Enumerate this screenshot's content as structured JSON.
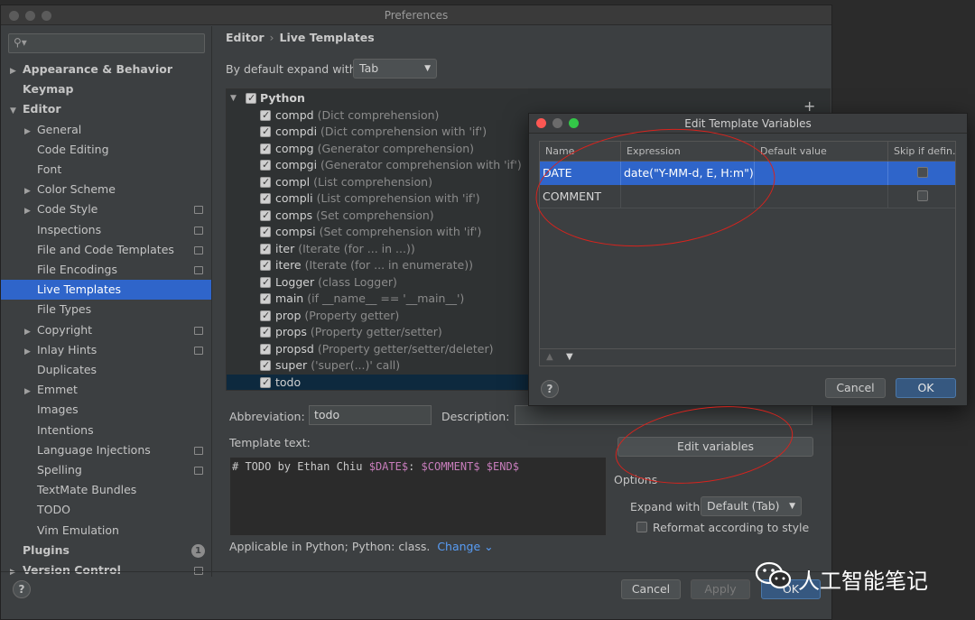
{
  "window": {
    "title": "Preferences"
  },
  "search": {
    "placeholder": ""
  },
  "sidebar": {
    "items": [
      {
        "label": "Appearance & Behavior",
        "bold": true,
        "arrow": "▶"
      },
      {
        "label": "Keymap",
        "bold": true
      },
      {
        "label": "Editor",
        "bold": true,
        "arrow": "▼"
      },
      {
        "label": "General",
        "arrow": "▶"
      },
      {
        "label": "Code Editing"
      },
      {
        "label": "Font"
      },
      {
        "label": "Color Scheme",
        "arrow": "▶"
      },
      {
        "label": "Code Style",
        "arrow": "▶",
        "copy": true
      },
      {
        "label": "Inspections",
        "copy": true
      },
      {
        "label": "File and Code Templates",
        "copy": true
      },
      {
        "label": "File Encodings",
        "copy": true
      },
      {
        "label": "Live Templates",
        "selected": true
      },
      {
        "label": "File Types"
      },
      {
        "label": "Copyright",
        "arrow": "▶",
        "copy": true
      },
      {
        "label": "Inlay Hints",
        "arrow": "▶",
        "copy": true
      },
      {
        "label": "Duplicates"
      },
      {
        "label": "Emmet",
        "arrow": "▶"
      },
      {
        "label": "Images"
      },
      {
        "label": "Intentions"
      },
      {
        "label": "Language Injections",
        "copy": true
      },
      {
        "label": "Spelling",
        "copy": true
      },
      {
        "label": "TextMate Bundles"
      },
      {
        "label": "TODO"
      },
      {
        "label": "Vim Emulation"
      },
      {
        "label": "Plugins",
        "bold": true,
        "badge": "1"
      },
      {
        "label": "Version Control",
        "bold": true,
        "arrow": "▶",
        "copy": true
      }
    ]
  },
  "breadcrumb": {
    "parent": "Editor",
    "separator": "›",
    "current": "Live Templates"
  },
  "expand": {
    "label": "By default expand with",
    "value": "Tab"
  },
  "templates": {
    "group": "Python",
    "items": [
      {
        "abbr": "compd",
        "desc": "(Dict comprehension)"
      },
      {
        "abbr": "compdi",
        "desc": "(Dict comprehension with 'if')"
      },
      {
        "abbr": "compg",
        "desc": "(Generator comprehension)"
      },
      {
        "abbr": "compgi",
        "desc": "(Generator comprehension with 'if')"
      },
      {
        "abbr": "compl",
        "desc": "(List comprehension)"
      },
      {
        "abbr": "compli",
        "desc": "(List comprehension with 'if')"
      },
      {
        "abbr": "comps",
        "desc": "(Set comprehension)"
      },
      {
        "abbr": "compsi",
        "desc": "(Set comprehension with 'if')"
      },
      {
        "abbr": "iter",
        "desc": "(Iterate (for ... in ...))"
      },
      {
        "abbr": "itere",
        "desc": "(Iterate (for ... in enumerate))"
      },
      {
        "abbr": "Logger",
        "desc": "(class Logger)"
      },
      {
        "abbr": "main",
        "desc": "(if __name__ == '__main__')"
      },
      {
        "abbr": "prop",
        "desc": "(Property getter)"
      },
      {
        "abbr": "props",
        "desc": "(Property getter/setter)"
      },
      {
        "abbr": "propsd",
        "desc": "(Property getter/setter/deleter)"
      },
      {
        "abbr": "super",
        "desc": "('super(...)' call)"
      },
      {
        "abbr": "todo",
        "desc": "",
        "selected": true
      }
    ]
  },
  "abbreviation": {
    "label": "Abbreviation:",
    "value": "todo"
  },
  "description": {
    "label": "Description:",
    "value": ""
  },
  "template_text": {
    "label": "Template text:",
    "prefix": "# TODO by Ethan Chiu ",
    "var1": "$DATE$",
    "mid": ": ",
    "var2": "$COMMENT$",
    "space": " ",
    "var3": "$END$"
  },
  "edit_variables": {
    "label": "Edit variables"
  },
  "options": {
    "title": "Options",
    "expand_label": "Expand with",
    "expand_value": "Default (Tab)",
    "reformat_label": "Reformat according to style"
  },
  "applicable": {
    "text": "Applicable in Python; Python: class.",
    "link": "Change"
  },
  "footer": {
    "help": "?",
    "cancel": "Cancel",
    "apply": "Apply",
    "ok": "OK"
  },
  "dialog": {
    "title": "Edit Template Variables",
    "columns": [
      "Name",
      "Expression",
      "Default value",
      "Skip if defin..."
    ],
    "rows": [
      {
        "name": "DATE",
        "expression": "date(\"Y-MM-d, E, H:m\")",
        "default": "",
        "selected": true
      },
      {
        "name": "COMMENT",
        "expression": "",
        "default": ""
      }
    ],
    "help": "?",
    "cancel": "Cancel",
    "ok": "OK"
  },
  "watermark": {
    "text": "人工智能笔记"
  },
  "colors": {
    "accent": "#2f65ca",
    "annotation": "#d8231d",
    "template_var": "#c77dbb",
    "link": "#589df6"
  }
}
